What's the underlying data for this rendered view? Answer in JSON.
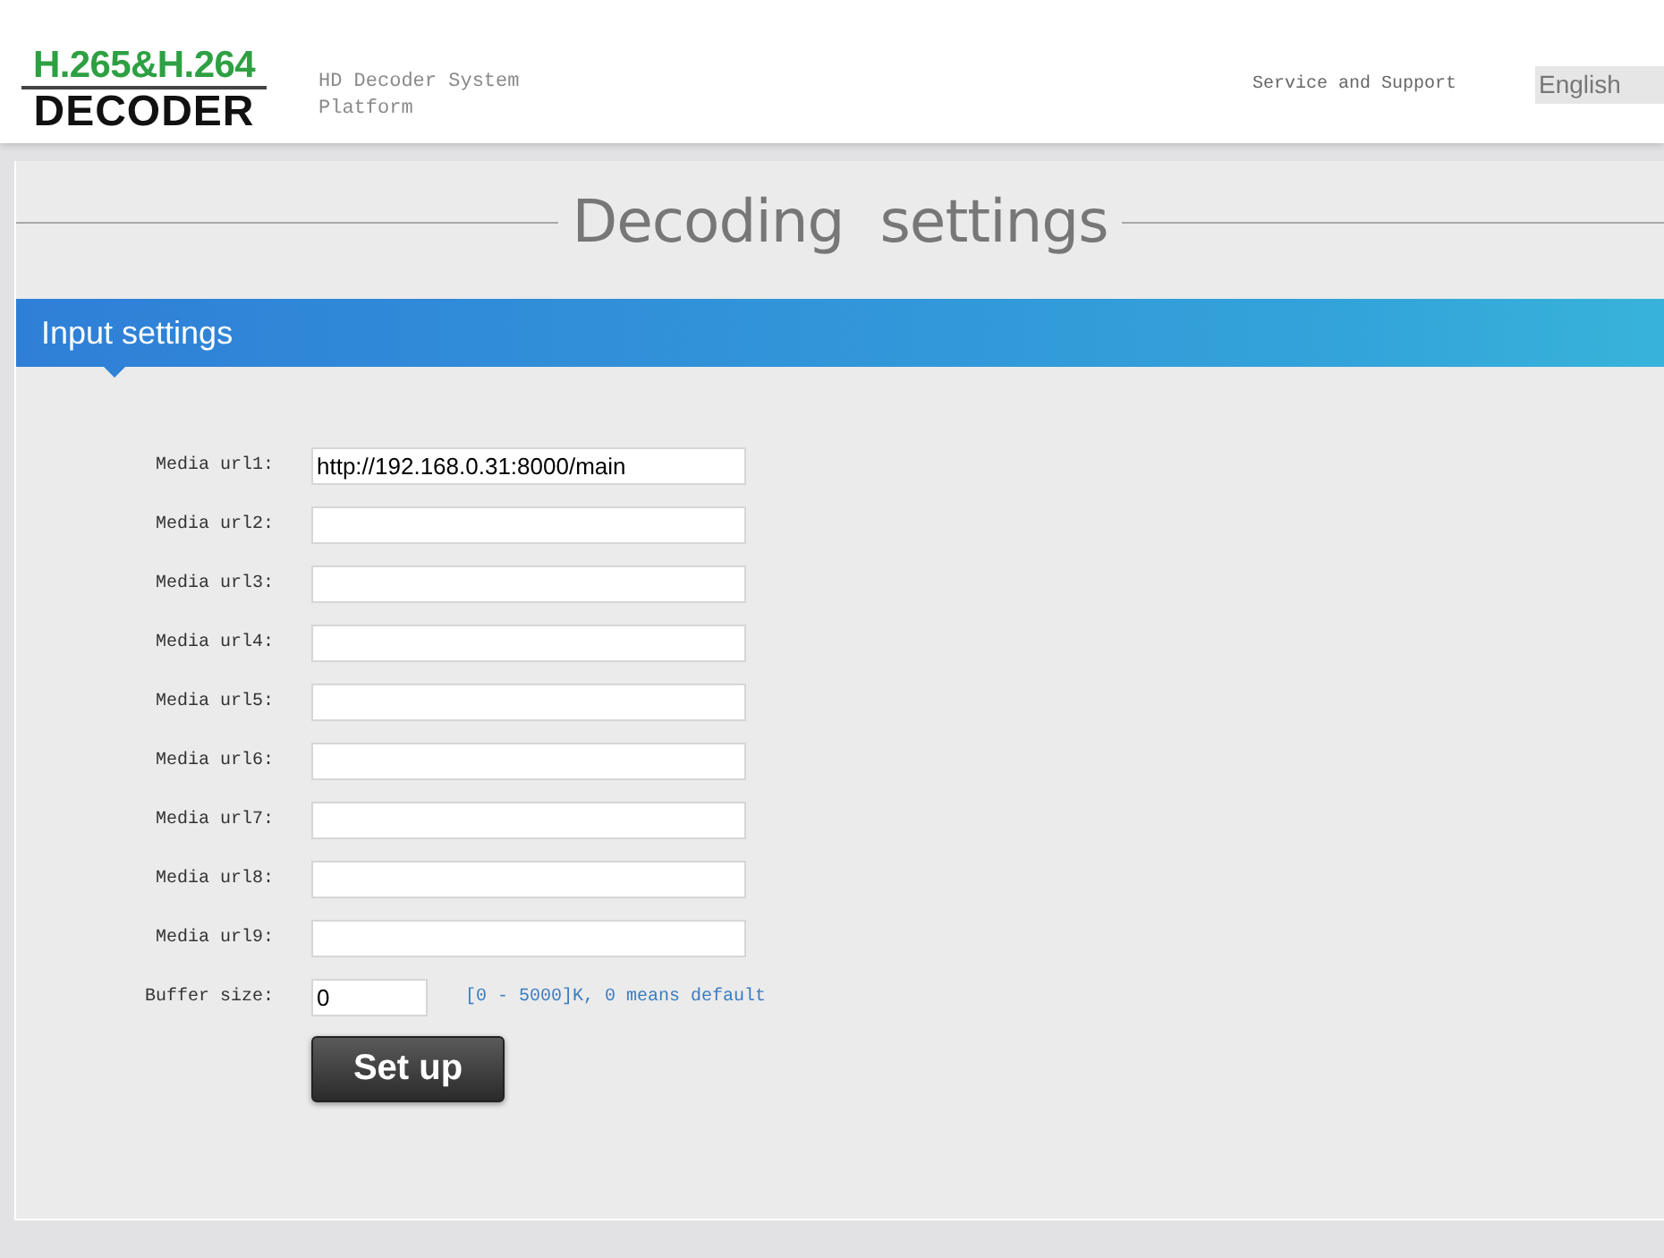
{
  "header": {
    "logo": {
      "line_1": "H.265&H.264",
      "line_2": "DECODER"
    },
    "subtitle_lines": [
      "HD Decoder System",
      "Platform"
    ],
    "links": [
      {
        "label": "Service and Support"
      }
    ],
    "language": {
      "value": "English"
    }
  },
  "page_title": "Decoding  settings",
  "section": {
    "title": "Input settings"
  },
  "fields": [
    {
      "kind": "url",
      "label": "Media url1:",
      "value": "http://192.168.0.31:8000/main"
    },
    {
      "kind": "url",
      "label": "Media url2:"
    },
    {
      "kind": "url",
      "label": "Media url3:"
    },
    {
      "kind": "url",
      "label": "Media url4:"
    },
    {
      "kind": "url",
      "label": "Media url5:"
    },
    {
      "kind": "url",
      "label": "Media url6:"
    },
    {
      "kind": "url",
      "label": "Media url7:"
    },
    {
      "kind": "url",
      "label": "Media url8:"
    },
    {
      "kind": "url",
      "label": "Media url9:"
    },
    {
      "kind": "number",
      "label": "Buffer size:",
      "value": "0",
      "hint": "[0 - 5000]K, 0 means default"
    }
  ],
  "buttons": [
    {
      "label": "Set up"
    }
  ]
}
